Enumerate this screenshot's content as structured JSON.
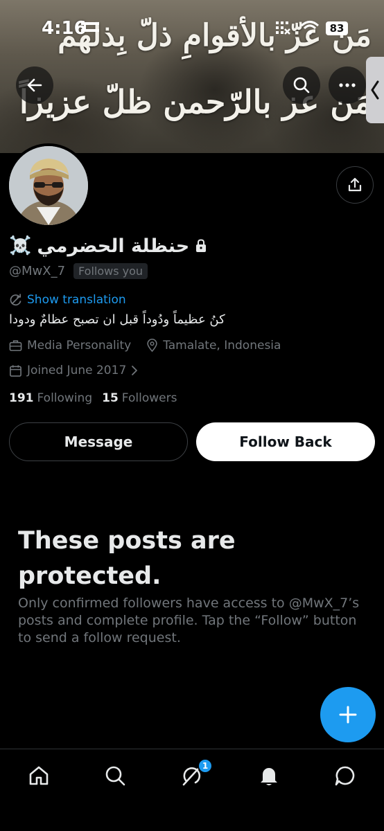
{
  "status_bar": {
    "time": "4:16",
    "battery": "83"
  },
  "banner": {
    "line1": "مَن عزّ بالأقوامِ ذلّ بِذلهم",
    "line2": "مَن عز بالرّحمن ظلّ عزيزاً"
  },
  "profile": {
    "display_name": "حنظلة الحضرمي",
    "name_emoji": "☠️",
    "handle": "@MwX_7",
    "follows_you": "Follows you",
    "show_translation": "Show translation",
    "bio": "كنُ عظيماً ودُوداً قبل ان تصبح عظامٌ ودودا",
    "category": "Media Personality",
    "location": "Tamalate, Indonesia",
    "joined": "Joined June 2017",
    "following_count": "191",
    "following_label": "Following",
    "followers_count": "15",
    "followers_label": "Followers"
  },
  "actions": {
    "message": "Message",
    "follow_back": "Follow Back"
  },
  "protected": {
    "title": "These posts are protected.",
    "description": "Only confirmed followers have access to @MwX_7’s posts and complete profile. Tap the “Follow” button to send a follow request."
  },
  "bottom_nav": {
    "items": [
      "home-icon",
      "search-icon",
      "grok-icon",
      "notifications-icon",
      "messages-icon"
    ],
    "badge": "1"
  },
  "colors": {
    "accent": "#1d9bf0",
    "background": "#000000",
    "muted": "#71767b",
    "text": "#e7e9ea"
  }
}
